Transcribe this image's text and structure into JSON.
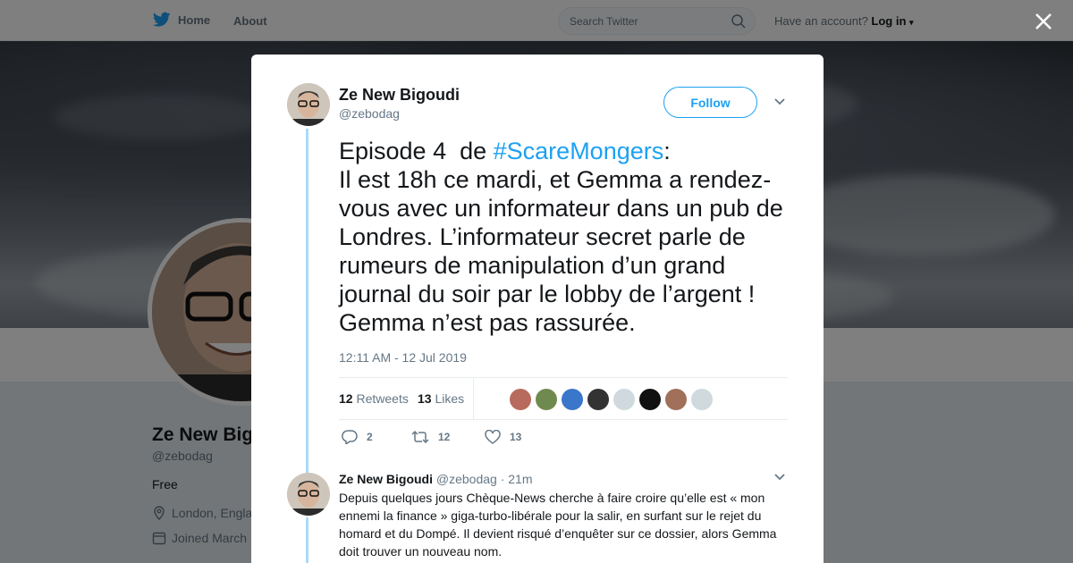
{
  "nav": {
    "home_label": "Home",
    "about_label": "About",
    "search_placeholder": "Search Twitter",
    "account_prompt": "Have an account?",
    "login_label": "Log in"
  },
  "profile": {
    "name": "Ze New Bigoudi",
    "handle": "@zebodag",
    "bio": "Free",
    "location": "London, Engla",
    "joined": "Joined March"
  },
  "tweet": {
    "author_name": "Ze New Bigoudi",
    "author_handle": "@zebodag",
    "follow_label": "Follow",
    "text_before": "Episode 4  de ",
    "hashtag": "#ScareMongers",
    "text_after": ":\nIl est 18h ce mardi, et Gemma a rendez-vous avec un informateur dans un pub de Londres. L’informateur secret parle de rumeurs de manipulation d’un grand journal du soir par le lobby de l’argent ! Gemma n’est pas rassurée.",
    "timestamp": "12:11 AM - 12 Jul 2019",
    "retweets_count": "12",
    "retweets_label": "Retweets",
    "likes_count": "13",
    "likes_label": "Likes",
    "liker_colors": [
      "#b86b5c",
      "#6f8a4e",
      "#3a76c9",
      "#333333",
      "#cfd9de",
      "#111111",
      "#a0705a",
      "#cfd9de"
    ],
    "replies_count": "2",
    "retweet_action_count": "12",
    "like_action_count": "13"
  },
  "reply": {
    "author_name": "Ze New Bigoudi",
    "author_handle": "@zebodag",
    "time": "· 21m",
    "text": "Depuis quelques jours Chèque-News cherche à faire croire qu’elle est « mon ennemi la finance » giga-turbo-libérale pour la salir, en surfant sur le rejet du homard et du Dompé. Il devient risqué d’enquêter sur ce dossier, alors Gemma doit trouver un nouveau nom."
  },
  "colors": {
    "accent": "#1da1f2",
    "thread_line": "#a7dbfa"
  }
}
